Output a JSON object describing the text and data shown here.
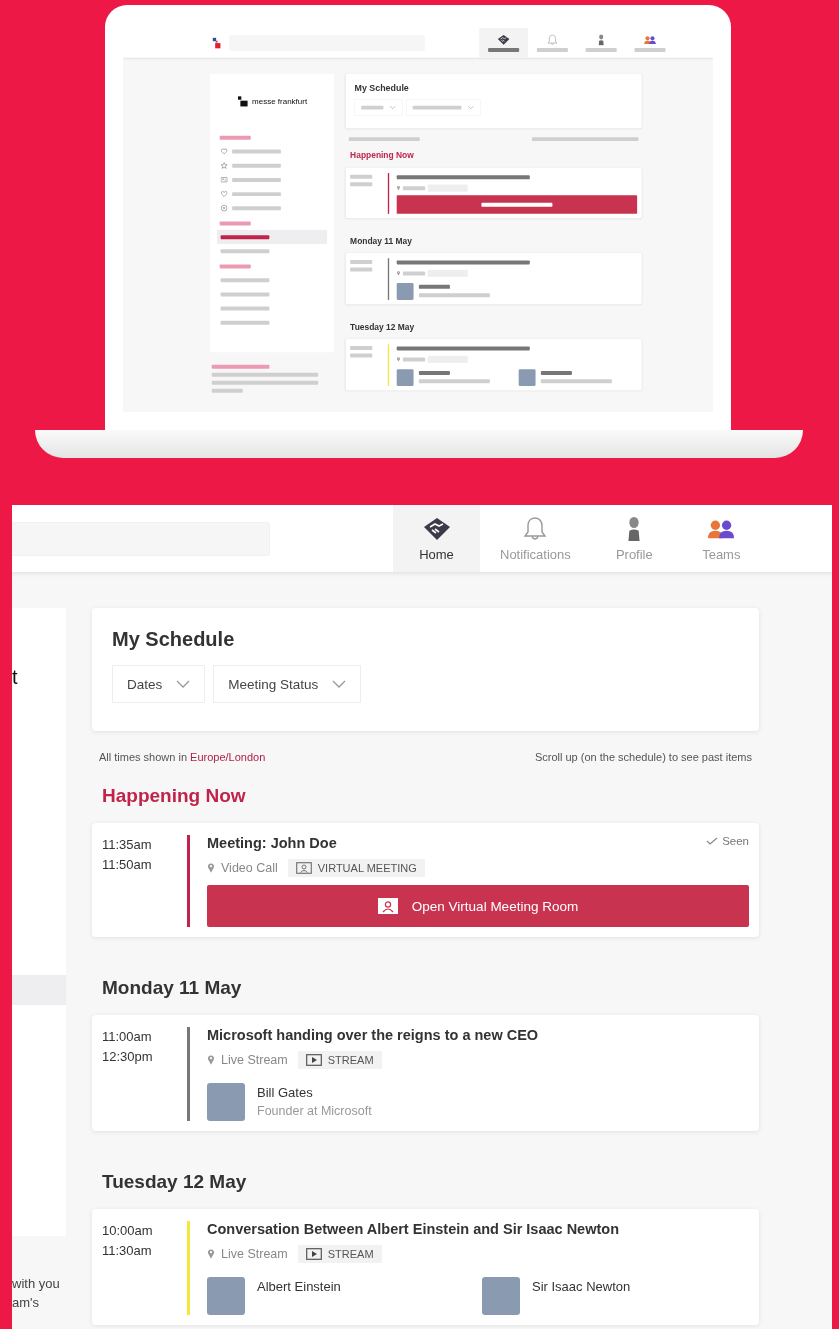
{
  "laptop_screen": {
    "nav": [
      {
        "kind": "home",
        "selected": true
      },
      {
        "kind": "notifications",
        "selected": false
      },
      {
        "kind": "profile",
        "selected": false
      },
      {
        "kind": "teams",
        "selected": false
      }
    ],
    "sidebar": {
      "logo_text": "messe frankfurt",
      "sections": [
        {
          "items": [
            {
              "kind": "recommended",
              "selected": false
            },
            {
              "kind": "interested",
              "selected": false
            },
            {
              "kind": "connections",
              "selected": false
            },
            {
              "kind": "liked",
              "selected": false
            },
            {
              "kind": "skipped",
              "selected": false
            }
          ]
        },
        {
          "items": [
            {
              "kind": "plain",
              "selected": true
            },
            {
              "kind": "plain",
              "selected": false
            }
          ]
        },
        {
          "items": [
            {
              "kind": "plain",
              "selected": false
            },
            {
              "kind": "plain",
              "selected": false
            },
            {
              "kind": "plain",
              "selected": false
            },
            {
              "kind": "plain",
              "selected": false
            }
          ]
        }
      ]
    },
    "schedule": {
      "title": "My Schedule",
      "groups": [
        {
          "kind": "now",
          "heading": "Happening Now",
          "events": [
            {
              "kind": "meeting",
              "color": "#c0244a"
            }
          ]
        },
        {
          "kind": "day",
          "heading": "Monday 11 May",
          "events": [
            {
              "kind": "solo_talk",
              "color": "#777777"
            }
          ]
        },
        {
          "kind": "day",
          "heading": "Tuesday 12 May",
          "events": [
            {
              "kind": "panel_talk",
              "color": "#f2e93a"
            }
          ]
        }
      ]
    }
  },
  "zoomed_view": {
    "header": {
      "nav": [
        {
          "kind": "home",
          "label": "Home",
          "selected": true
        },
        {
          "kind": "notifications",
          "label": "Notifications",
          "selected": false
        },
        {
          "kind": "profile",
          "label": "Profile",
          "selected": false
        },
        {
          "kind": "teams",
          "label": "Teams",
          "selected": false
        }
      ]
    },
    "sidebar": {
      "logo_fragment": "t",
      "items": [
        {
          "selected": true
        }
      ],
      "share_fragments": [
        "with you",
        "am's"
      ]
    },
    "schedule": {
      "title": "My Schedule",
      "filters": [
        "Dates",
        "Meeting Status"
      ],
      "timezone_note": {
        "text": "All times shown in ",
        "link": "Europe/London"
      },
      "scroll_hint": "Scroll up (on the schedule) to see past items",
      "groups": [
        {
          "kind": "now",
          "heading": "Happening Now",
          "events": [
            {
              "start": "11:35am",
              "end": "11:50am",
              "color": "#c0244a",
              "title": "Meeting: John Doe",
              "location": "Video Call",
              "tag": {
                "kind": "virtual",
                "label": "VIRTUAL MEETING"
              },
              "status": "Seen",
              "action": "Open Virtual Meeting Room"
            }
          ]
        },
        {
          "kind": "day",
          "heading": "Monday 11 May",
          "events": [
            {
              "start": "11:00am",
              "end": "12:30pm",
              "color": "#777777",
              "title": "Microsoft handing over the reigns to a new CEO",
              "location": "Live Stream",
              "tag": {
                "kind": "stream",
                "label": "STREAM"
              },
              "speakers": [
                {
                  "name": "Bill Gates",
                  "role": "Founder at Microsoft"
                }
              ]
            }
          ]
        },
        {
          "kind": "day",
          "heading": "Tuesday 12 May",
          "events": [
            {
              "start": "10:00am",
              "end": "11:30am",
              "color": "#f2e93a",
              "title": "Conversation Between Albert Einstein and Sir Isaac Newton",
              "location": "Live Stream",
              "tag": {
                "kind": "stream",
                "label": "STREAM"
              },
              "speakers": [
                {
                  "name": "Albert Einstein"
                },
                {
                  "name": "Sir Isaac Newton"
                }
              ]
            }
          ]
        }
      ]
    }
  }
}
